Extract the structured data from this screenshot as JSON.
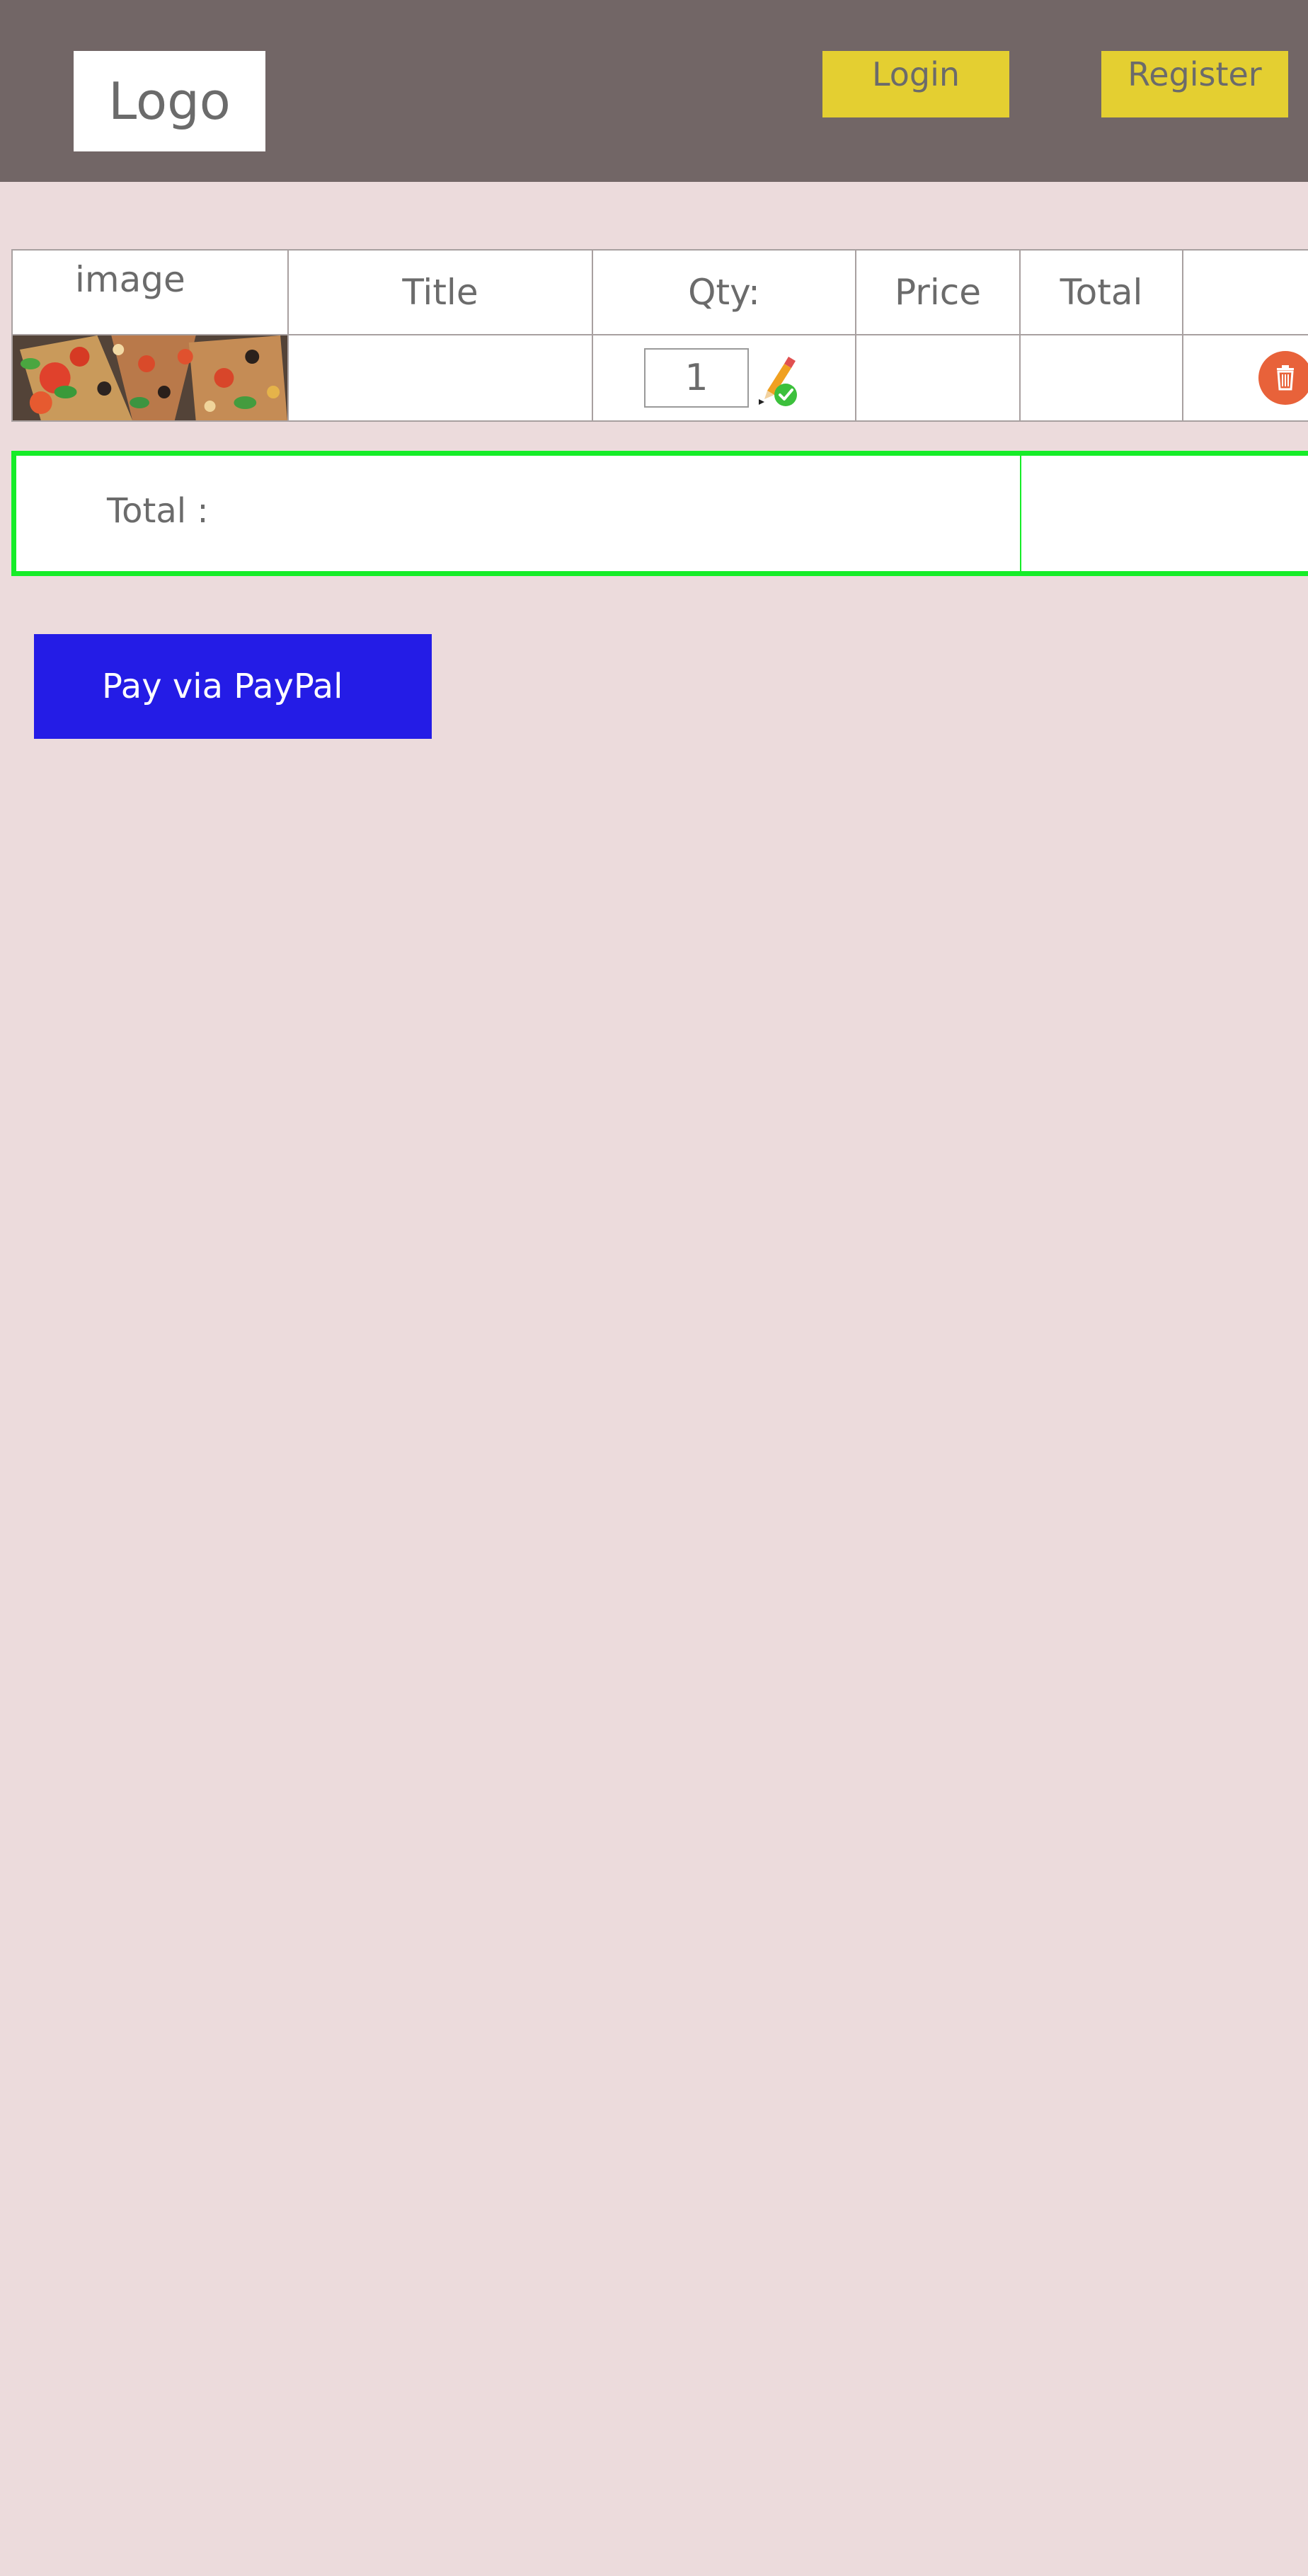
{
  "header": {
    "logo_text": "Logo",
    "login_label": "Login",
    "register_label": "Register"
  },
  "cart": {
    "columns": [
      "image",
      "Title",
      "Qty:",
      "Price",
      "Total",
      ""
    ],
    "rows": [
      {
        "image": "pizza-image",
        "title": "",
        "qty": "1",
        "price": "",
        "total": ""
      }
    ]
  },
  "summary": {
    "total_label": "Total :",
    "total_value": ""
  },
  "paypal": {
    "label": "Pay via PayPal"
  },
  "colors": {
    "page_background": "#ecdbdc",
    "header_background": "#726666",
    "nav_button": "#e4cf31",
    "total_border": "#16ec28",
    "paypal_button": "#241ce6",
    "delete_icon": "#e8623a",
    "text": "#6b6b6b"
  },
  "icons": {
    "update": "pencil-check-icon",
    "delete": "trash-icon"
  }
}
